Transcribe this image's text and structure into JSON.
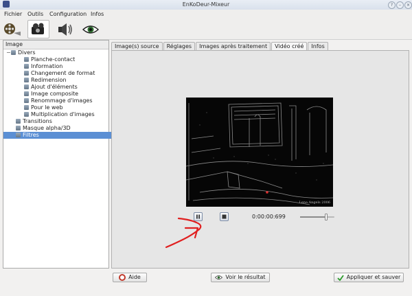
{
  "window": {
    "title": "EnKoDeur-Mixeur"
  },
  "menu": [
    "Fichier",
    "Outils",
    "Configuration",
    "Infos"
  ],
  "toolbar": {
    "tools": [
      {
        "name": "film-reel-icon",
        "active": false
      },
      {
        "name": "projector-icon",
        "active": true
      },
      {
        "name": "speaker-icon",
        "active": false
      },
      {
        "name": "eye-icon",
        "active": false
      }
    ]
  },
  "sidebar": {
    "header": "Image",
    "tree": [
      {
        "label": "Divers",
        "level": 0,
        "expanded": true
      },
      {
        "label": "Planche-contact",
        "level": 1
      },
      {
        "label": "Information",
        "level": 1
      },
      {
        "label": "Changement de format",
        "level": 1
      },
      {
        "label": "Redimension",
        "level": 1
      },
      {
        "label": "Ajout d'éléments",
        "level": 1
      },
      {
        "label": "Image composite",
        "level": 1
      },
      {
        "label": "Renommage d'images",
        "level": 1
      },
      {
        "label": "Pour le web",
        "level": 1
      },
      {
        "label": "Multiplication d'images",
        "level": 1
      },
      {
        "label": "Transitions",
        "level": 0
      },
      {
        "label": "Masque alpha/3D",
        "level": 0
      },
      {
        "label": "Filtres",
        "level": 0,
        "selected": true
      }
    ]
  },
  "tabs": [
    {
      "label": "Image(s) source",
      "active": false
    },
    {
      "label": "Réglages",
      "active": false
    },
    {
      "label": "Images après traitement",
      "active": false
    },
    {
      "label": "Vidéo créé",
      "active": true
    },
    {
      "label": "Infos",
      "active": false
    }
  ],
  "player": {
    "timecode": "0:00:00:699",
    "volume_fraction": 0.75,
    "watermark": "Lena Angels 2006"
  },
  "footer": {
    "help_label": "Aide",
    "preview_label": "Voir le résultat",
    "apply_label": "Appliquer et sauver"
  },
  "colors": {
    "selection": "#5b8fd4",
    "annotation": "#e02020"
  }
}
